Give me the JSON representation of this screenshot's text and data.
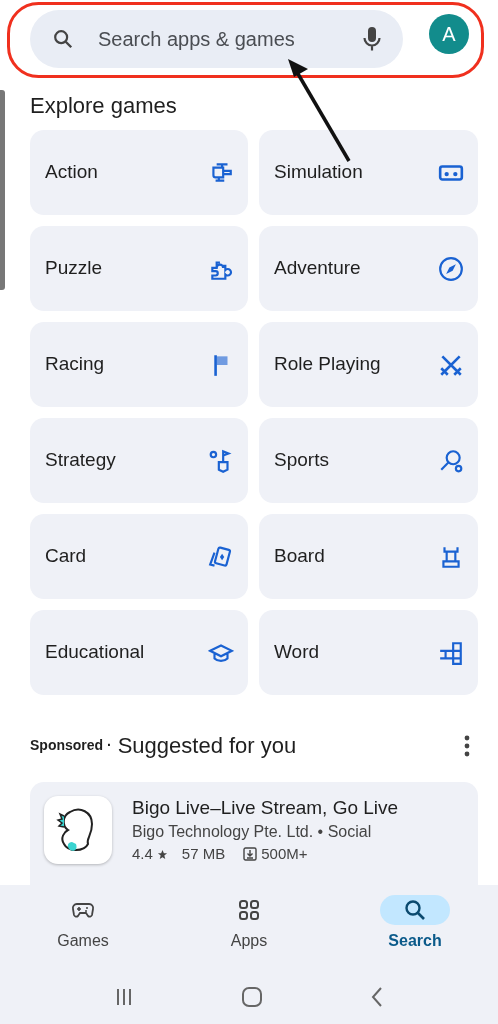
{
  "search": {
    "placeholder": "Search apps & games"
  },
  "account": {
    "initial": "A",
    "color": "#128c8c"
  },
  "annotation": [
    {
      "kind": "outline"
    },
    {
      "kind": "arrow"
    }
  ],
  "explore": {
    "title": "Explore games",
    "categories": [
      {
        "label": "Action"
      },
      {
        "label": "Simulation"
      },
      {
        "label": "Puzzle"
      },
      {
        "label": "Adventure"
      },
      {
        "label": "Racing"
      },
      {
        "label": "Role Playing"
      },
      {
        "label": "Strategy"
      },
      {
        "label": "Sports"
      },
      {
        "label": "Card"
      },
      {
        "label": "Board"
      },
      {
        "label": "Educational"
      },
      {
        "label": "Word"
      }
    ]
  },
  "suggested": {
    "sponsored": "Sponsored ·",
    "title": "Suggested for you",
    "apps": [
      {
        "name": "Bigo Live–Live Stream, Go Live",
        "developer": "Bigo Technology Pte. Ltd. • Social",
        "rating": "4.4",
        "size": "57 MB",
        "downloads": "500M+"
      }
    ]
  },
  "bottom_nav": [
    {
      "label": "Games",
      "selected": false
    },
    {
      "label": "Apps",
      "selected": false
    },
    {
      "label": "Search",
      "selected": true
    }
  ]
}
